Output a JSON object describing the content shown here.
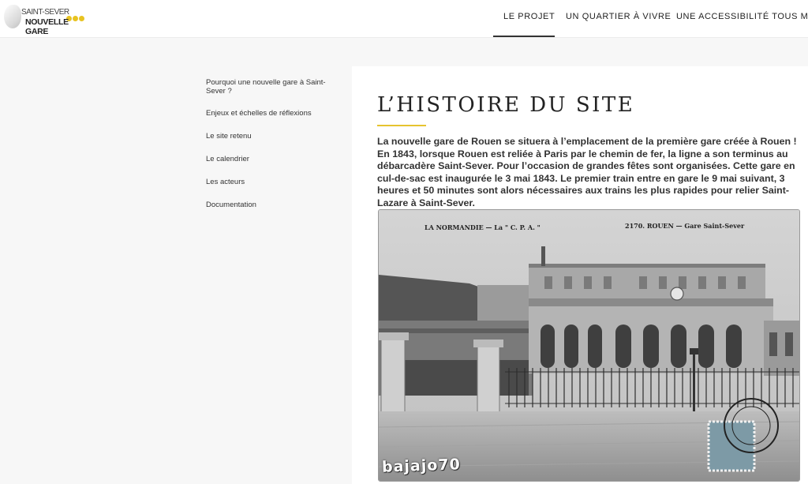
{
  "header": {
    "logo": {
      "line1": "SAINT-SEVER",
      "line2": "NOUVELLE GARE",
      "dot_color": "#e8c321"
    },
    "nav": [
      {
        "label": "LE PROJET",
        "active": true
      },
      {
        "label": "UN QUARTIER À VIVRE",
        "active": false
      },
      {
        "label": "UNE ACCESSIBILITÉ TOUS MODES",
        "active": false
      }
    ]
  },
  "sidebar": {
    "items": [
      {
        "label": "Pourquoi une nouvelle gare à Saint-Sever ?"
      },
      {
        "label": "Enjeux et échelles de réflexions"
      },
      {
        "label": "Le site retenu"
      },
      {
        "label": "Le calendrier"
      },
      {
        "label": "Les acteurs"
      },
      {
        "label": "Documentation"
      }
    ]
  },
  "main": {
    "title": "L’HISTOIRE DU SITE",
    "accent_color": "#e6c42f",
    "intro": "La nouvelle gare de Rouen se situera à l’emplacement de la première gare créée à Rouen ! En 1843, lorsque Rouen est reliée à Paris par le chemin de fer, la ligne a son terminus au débarcadère Saint-Sever. Pour l’occasion de grandes fêtes sont organisées. Cette gare en cul-de-sac est inaugurée le 3 mai 1843. Le premier train entre en gare le 9 mai suivant, 3 heures et 50 minutes sont alors nécessaires aux trains les plus rapides pour relier Saint-Lazare à Saint-Sever.",
    "photo": {
      "caption_left": "LA NORMANDIE — La \" C. P. A. \"",
      "caption_right": "2170. ROUEN — Gare Saint-Sever",
      "watermark": "bajajo70"
    }
  }
}
